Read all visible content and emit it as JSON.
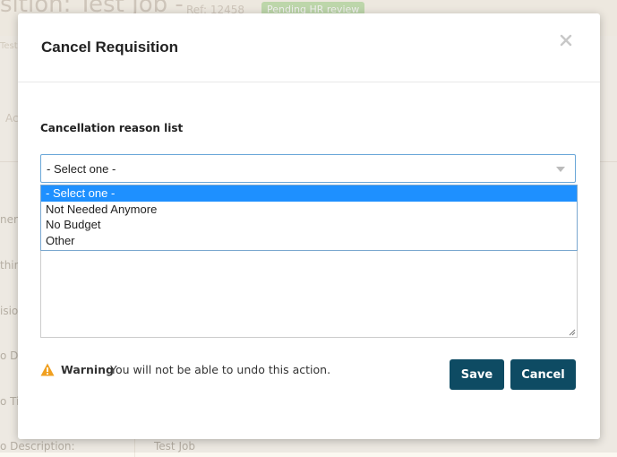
{
  "background": {
    "page_title": "sition: Test Job -",
    "ref": "Ref: 12458",
    "status_badge": "Pending HR review",
    "sub_text": "Test",
    "tab": "Ac",
    "labels": [
      "nera",
      "thin",
      "isio",
      "o Di",
      "o Tit",
      "o Description:"
    ],
    "job_value": "Test Job"
  },
  "modal": {
    "title": "Cancel Requisition",
    "field_label": "Cancellation reason list",
    "select": {
      "value": "- Select one -",
      "options": [
        "- Select one -",
        "Not Needed Anymore",
        "No Budget",
        "Other"
      ],
      "selected_index": 0
    },
    "warning": {
      "label": "Warning",
      "text": "You will not be able to undo this action."
    },
    "buttons": {
      "save": "Save",
      "cancel": "Cancel"
    }
  },
  "colors": {
    "primary_button": "#0e4b63",
    "dropdown_highlight": "#1e90ff",
    "warning_icon": "#f0a020"
  }
}
